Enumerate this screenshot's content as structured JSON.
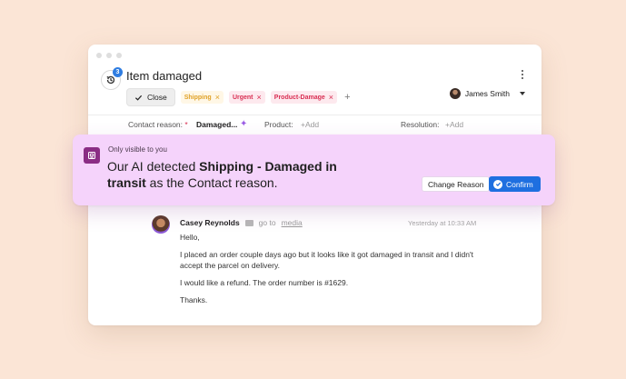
{
  "ticket": {
    "title": "Item damaged",
    "badge_count": "3",
    "close_label": "Close",
    "tags": [
      {
        "label": "Shipping",
        "color": "#e0a126"
      },
      {
        "label": "Urgent",
        "color": "#d92f53"
      },
      {
        "label": "Product-Damage",
        "color": "#d92f53"
      }
    ],
    "add_tag_symbol": "+",
    "assignee": "James Smith"
  },
  "fields": {
    "contact_reason_label": "Contact reason:",
    "contact_reason_required": "*",
    "contact_reason_value": "Damaged...",
    "product_label": "Product:",
    "product_value": "+Add",
    "resolution_label": "Resolution:",
    "resolution_value": "+Add"
  },
  "ai_banner": {
    "visibility": "Only visible to you",
    "message_prefix": "Our AI detected ",
    "message_bold": "Shipping - Damaged in transit",
    "message_suffix": " as the Contact reason.",
    "change_button": "Change Reason",
    "confirm_button": "Confirm"
  },
  "message": {
    "author": "Casey Reynolds",
    "goto_prefix": "go to",
    "goto_link": "media",
    "timestamp": "Yesterday at 10:33 AM",
    "paragraphs": [
      "Hello,",
      "I placed an order couple days ago but it looks like it got damaged in transit and I didn't accept the parcel on delivery.",
      "I would like a refund. The order number is #1629.",
      "Thanks."
    ]
  },
  "colors": {
    "background": "#fbe5d6",
    "banner": "#f5d3fb",
    "ai_icon": "#8a2d84",
    "confirm": "#1e6fe0",
    "badge": "#2f7de1"
  }
}
